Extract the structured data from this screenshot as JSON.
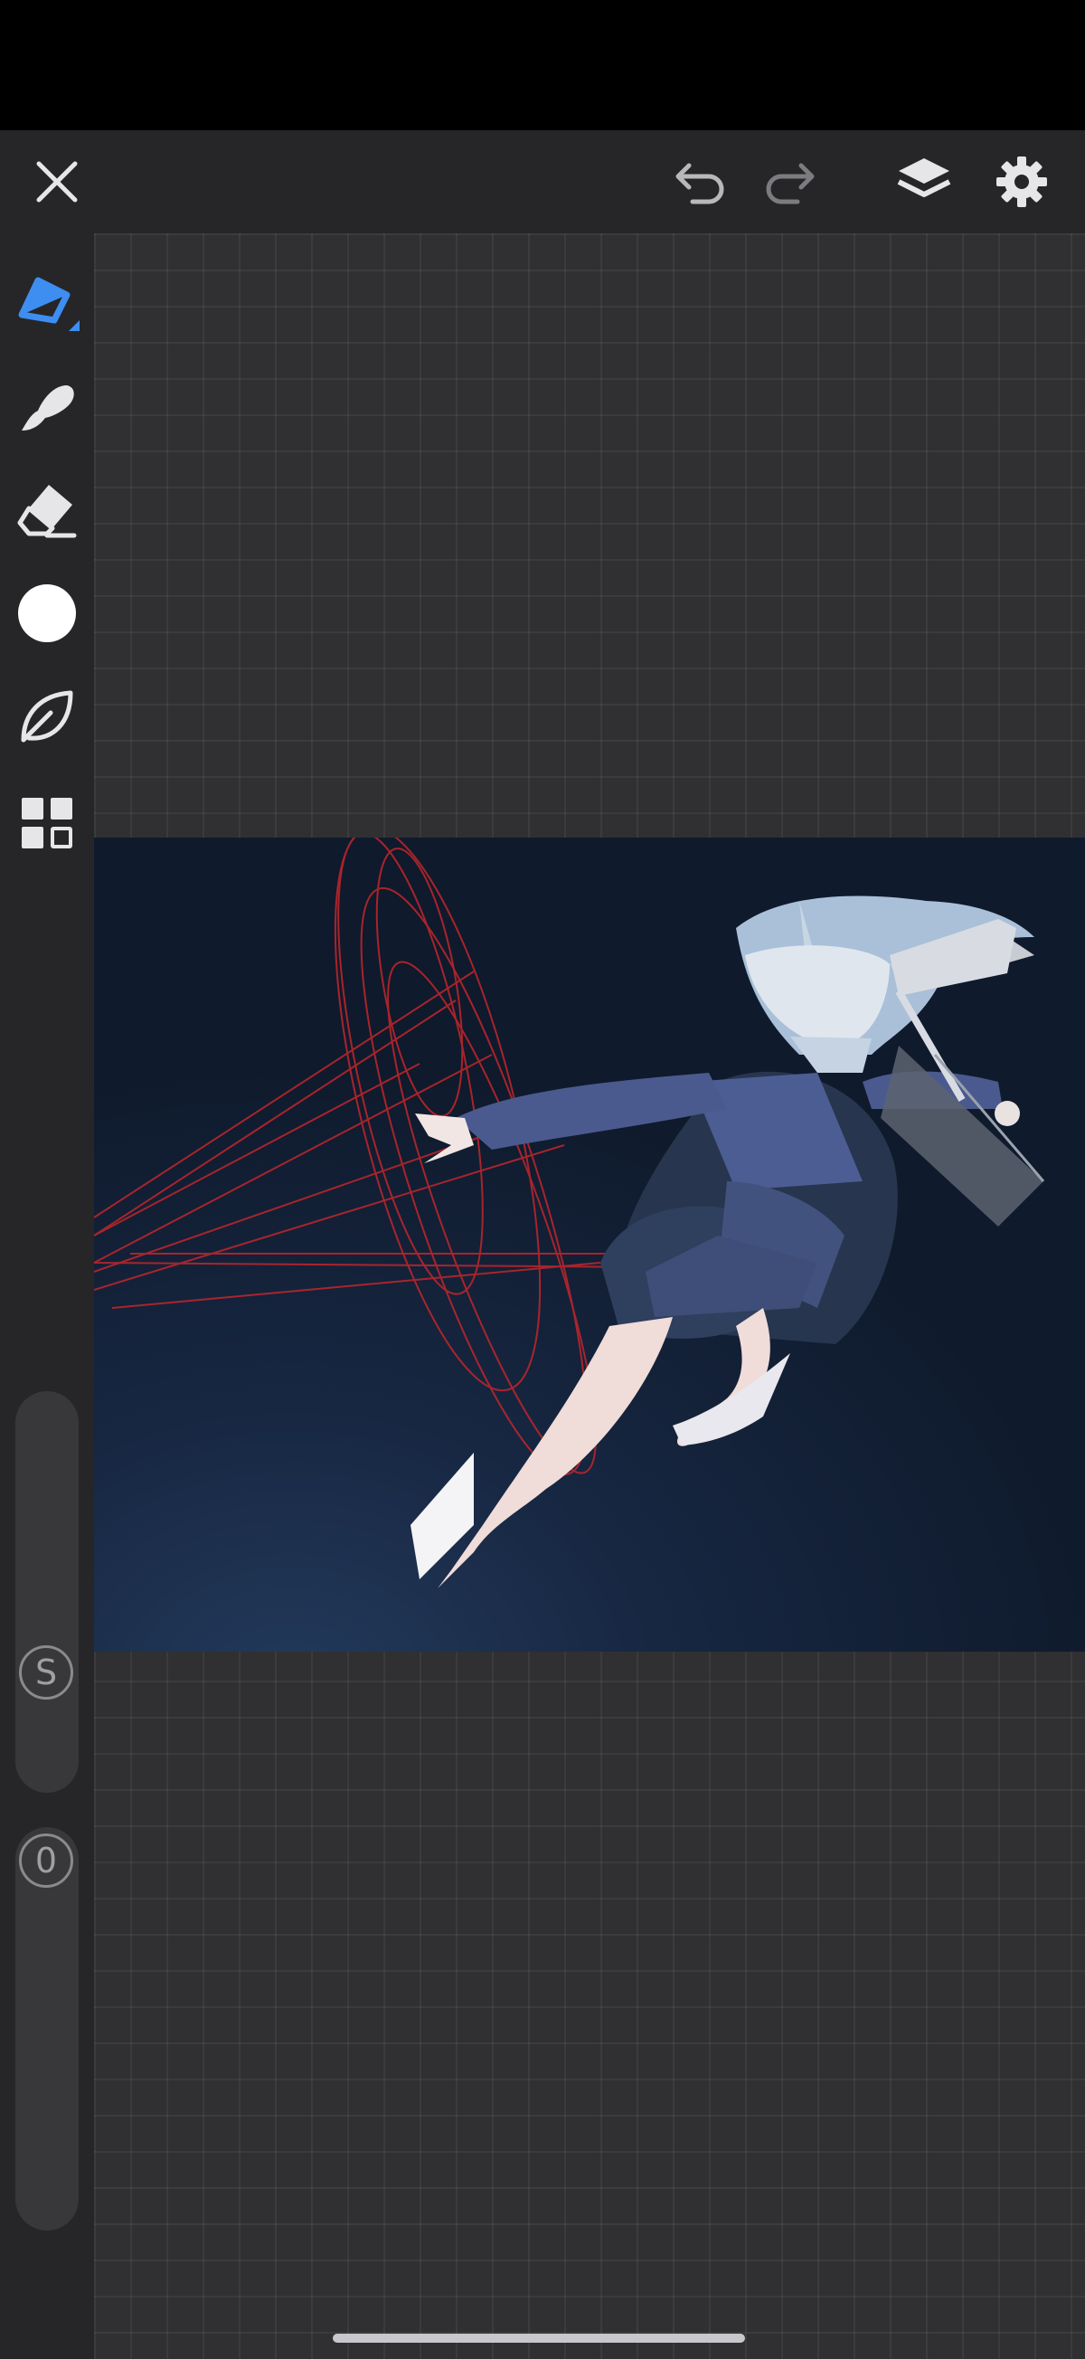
{
  "app": {
    "toolbar": {
      "close": {
        "icon": "close-icon"
      },
      "undo": {
        "icon": "undo-icon"
      },
      "redo": {
        "icon": "redo-icon"
      },
      "layers": {
        "icon": "layers-icon"
      },
      "settings": {
        "icon": "gear-icon"
      }
    },
    "tools": [
      {
        "name": "pen",
        "icon": "pen-tool-icon",
        "active": true
      },
      {
        "name": "brush",
        "icon": "brush-tool-icon",
        "active": false
      },
      {
        "name": "eraser",
        "icon": "eraser-tool-icon",
        "active": false
      },
      {
        "name": "color",
        "icon": "color-swatch-icon",
        "active": false,
        "color": "#ffffff"
      },
      {
        "name": "smudge",
        "icon": "leaf-tool-icon",
        "active": false
      },
      {
        "name": "more",
        "icon": "grid-menu-icon",
        "active": false
      }
    ],
    "size_slider": {
      "label": "S"
    },
    "opacity_slider": {
      "label": "0"
    }
  },
  "colors": {
    "accent": "#3d8ef0",
    "toolbar_bg": "#262628",
    "canvas_bg": "#303032",
    "artwork_bg": "#172742",
    "guide_lines": "#c3262b"
  }
}
